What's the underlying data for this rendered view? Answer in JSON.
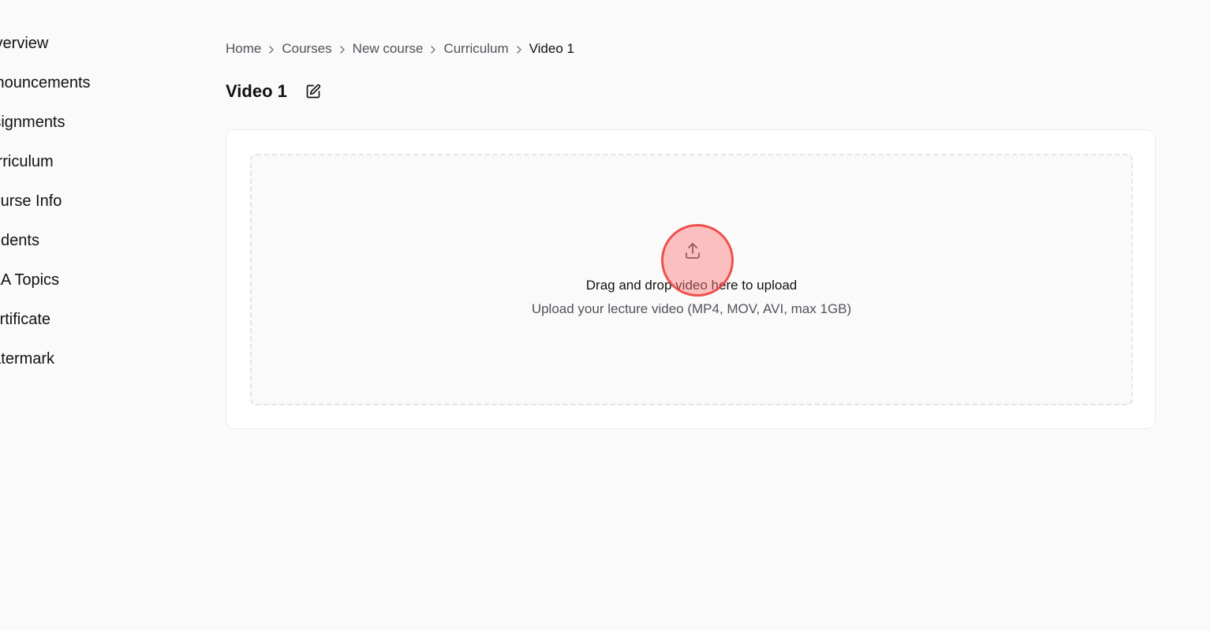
{
  "sidebar": {
    "items": [
      {
        "label": "Overview"
      },
      {
        "label": "Announcements"
      },
      {
        "label": "Assignments"
      },
      {
        "label": "Curriculum"
      },
      {
        "label": "Course Info"
      },
      {
        "label": "Students"
      },
      {
        "label": "Q&A Topics"
      },
      {
        "label": "Certificate"
      },
      {
        "label": "Watermark"
      }
    ]
  },
  "breadcrumb": {
    "items": [
      {
        "label": "Home"
      },
      {
        "label": "Courses"
      },
      {
        "label": "New course"
      },
      {
        "label": "Curriculum"
      },
      {
        "label": "Video 1"
      }
    ],
    "separator_icon": "chevron-right-icon"
  },
  "header": {
    "title": "Video 1",
    "edit_icon": "edit-icon"
  },
  "upload": {
    "icon": "upload-icon",
    "title": "Drag and drop video here to upload",
    "subtitle": "Upload your lecture video (MP4, MOV, AVI, max 1GB)"
  },
  "colors": {
    "background": "#fafafa",
    "card": "#ffffff",
    "border": "#e4e4e7",
    "muted_text": "#52525b",
    "click_indicator": "#ff7878"
  }
}
